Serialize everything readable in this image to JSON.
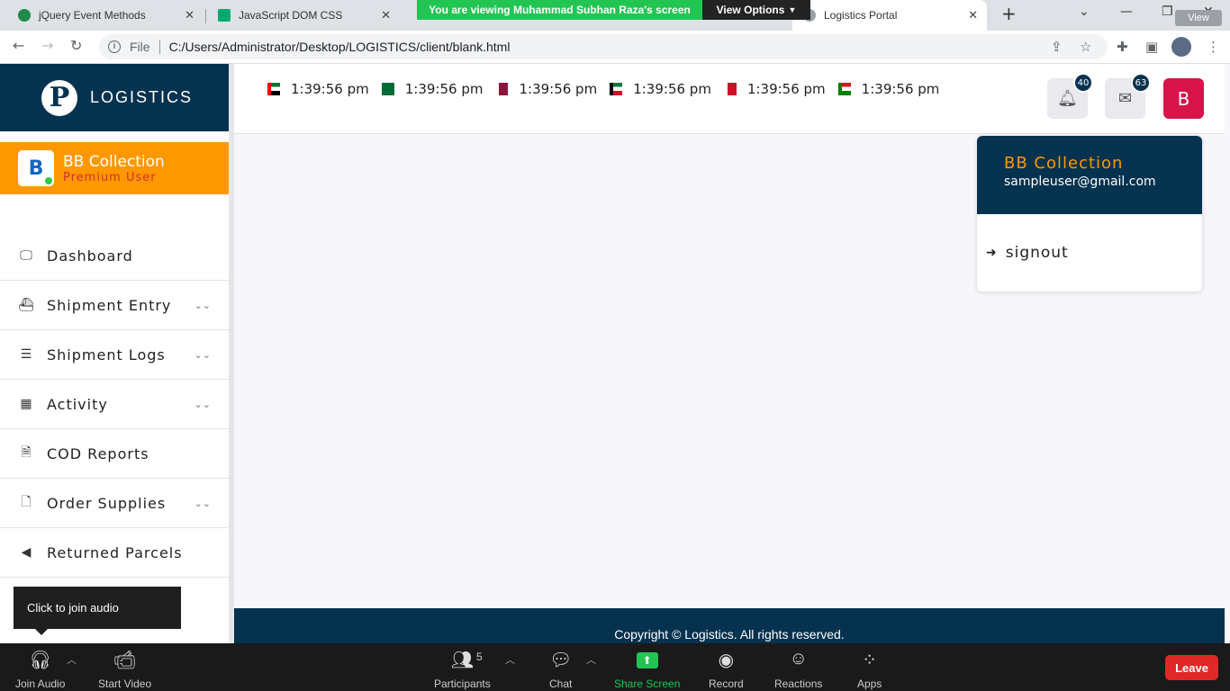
{
  "browser": {
    "tabs": [
      {
        "title": "jQuery Event Methods",
        "active": false
      },
      {
        "title": "JavaScript DOM CSS",
        "active": false
      },
      {
        "title": "Logistics Portal",
        "active": true
      }
    ],
    "share_banner": "You are viewing Muhammad Subhan Raza's screen",
    "view_options": "View Options",
    "view_chip": "View",
    "file_label": "File",
    "url": "C:/Users/Administrator/Desktop/LOGISTICS/client/blank.html"
  },
  "sidebar": {
    "brand_name": "LOGISTICS",
    "logo_letter": "P",
    "user_initial": "B",
    "user_name": "BB Collection",
    "user_role": "Premium User",
    "items": [
      {
        "label": "Dashboard",
        "icon": "monitor-icon",
        "glyph": "🖵",
        "chevron": false
      },
      {
        "label": "Shipment Entry",
        "icon": "ship-icon",
        "glyph": "⛴",
        "chevron": true
      },
      {
        "label": "Shipment Logs",
        "icon": "list-icon",
        "glyph": "☰",
        "chevron": true
      },
      {
        "label": "Activity",
        "icon": "table-icon",
        "glyph": "▦",
        "chevron": true
      },
      {
        "label": "COD Reports",
        "icon": "pdf-file-icon",
        "glyph": "🗎",
        "chevron": false
      },
      {
        "label": "Order Supplies",
        "icon": "file-icon",
        "glyph": "🗋",
        "chevron": true
      },
      {
        "label": "Returned Parcels",
        "icon": "arrow-left-circle-icon",
        "glyph": "◀",
        "chevron": false
      }
    ]
  },
  "topbar": {
    "clocks": [
      {
        "country": "UAE",
        "time": "1:39:56 pm",
        "flag_colors": [
          "#00732f",
          "#ffffff",
          "#000000",
          "#ff0000"
        ]
      },
      {
        "country": "Saudi Arabia",
        "time": "1:39:56 pm",
        "flag_colors": [
          "#006c35"
        ]
      },
      {
        "country": "Qatar",
        "time": "1:39:56 pm",
        "flag_colors": [
          "#8a1538",
          "#ffffff"
        ]
      },
      {
        "country": "Kuwait",
        "time": "1:39:56 pm",
        "flag_colors": [
          "#007a3d",
          "#ffffff",
          "#ce1126",
          "#000000"
        ]
      },
      {
        "country": "Bahrain",
        "time": "1:39:56 pm",
        "flag_colors": [
          "#ce1126",
          "#ffffff"
        ]
      },
      {
        "country": "Oman",
        "time": "1:39:56 pm",
        "flag_colors": [
          "#db161b",
          "#ffffff",
          "#008000"
        ]
      }
    ],
    "notifications_count": "40",
    "messages_count": "63",
    "avatar_initial": "B"
  },
  "dropdown": {
    "name": "BB Collection",
    "email": "sampleuser@gmail.com",
    "signout_label": "signout"
  },
  "footer": {
    "copyright": "Copyright © Logistics. All rights reserved."
  },
  "tooltip": {
    "text": "Click to join audio"
  },
  "zoom": {
    "join_audio": "Join Audio",
    "start_video": "Start Video",
    "participants": "Participants",
    "participants_count": "5",
    "chat": "Chat",
    "share_screen": "Share Screen",
    "record": "Record",
    "reactions": "Reactions",
    "apps": "Apps",
    "leave": "Leave"
  },
  "colors": {
    "brand_navy": "#05324f",
    "user_card_orange": "#ff9800",
    "avatar_red": "#d6144a",
    "share_green": "#23c552",
    "leave_red": "#e02828"
  }
}
